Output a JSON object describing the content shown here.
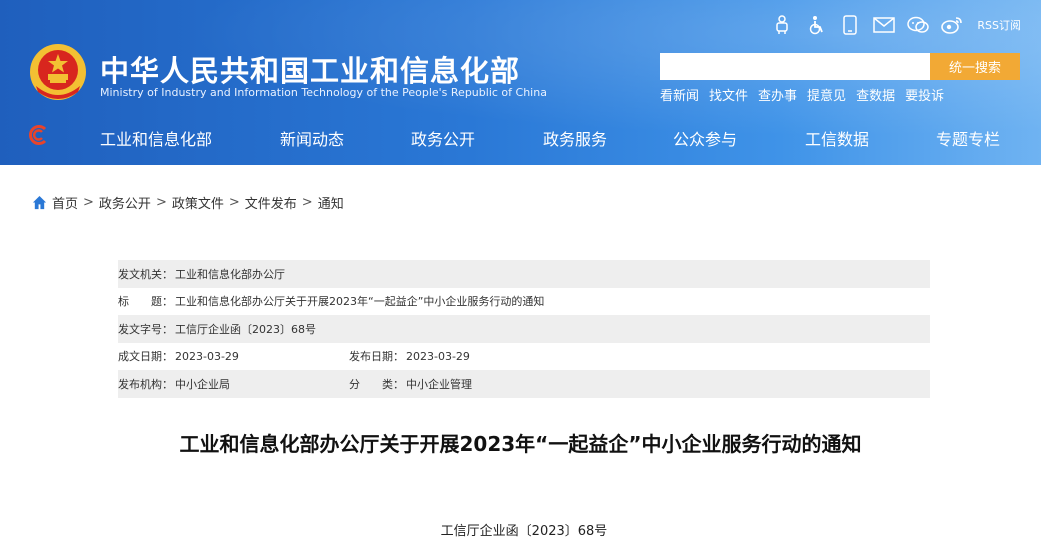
{
  "header": {
    "title": "中华人民共和国工业和信息化部",
    "subtitle": "Ministry of Industry and Information Technology of the People's Republic of China",
    "icons": [
      "accessibility-robot-icon",
      "wheelchair-icon",
      "mobile-icon",
      "mail-icon",
      "wechat-icon",
      "weibo-icon"
    ],
    "rss_label": "RSS订阅",
    "search_placeholder": "",
    "search_button": "统一搜索",
    "quick_links": [
      "看新闻",
      "找文件",
      "查办事",
      "提意见",
      "查数据",
      "要投诉"
    ],
    "nav": [
      "工业和信息化部",
      "新闻动态",
      "政务公开",
      "政务服务",
      "公众参与",
      "工信数据",
      "专题专栏"
    ]
  },
  "breadcrumb": [
    "首页",
    "政务公开",
    "政策文件",
    "文件发布",
    "通知"
  ],
  "meta": {
    "issuer_key": "发文机关：",
    "issuer": "工业和信息化部办公厅",
    "title_key": "标　　题：",
    "title": "工业和信息化部办公厅关于开展2023年“一起益企”中小企业服务行动的通知",
    "docno_key": "发文字号：",
    "docno": "工信厅企业函〔2023〕68号",
    "created_key": "成文日期：",
    "created": "2023-03-29",
    "published_key": "发布日期：",
    "published": "2023-03-29",
    "agency_key": "发布机构：",
    "agency": "中小企业局",
    "category_key": "分　　类：",
    "category": "中小企业管理"
  },
  "document": {
    "title": "工业和信息化部办公厅关于开展2023年“一起益企”中小企业服务行动的通知",
    "number": "工信厅企业函〔2023〕68号"
  },
  "colors": {
    "header_blue": "#2a78d6",
    "search_orange": "#f2a935",
    "meta_row_gray": "#eeeeee"
  }
}
